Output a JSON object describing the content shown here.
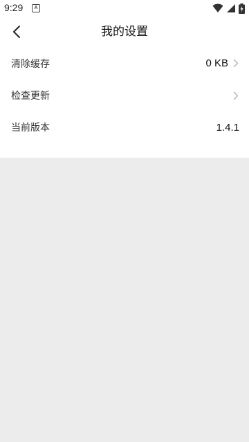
{
  "status_bar": {
    "time": "9:29",
    "notification_icon": "a-letter-icon",
    "icons": [
      "wifi-icon",
      "cellular-signal-icon",
      "battery-charging-icon"
    ]
  },
  "header": {
    "back_icon": "chevron-left-icon",
    "title": "我的设置"
  },
  "settings": {
    "items": [
      {
        "label": "清除缓存",
        "value": "0 KB",
        "has_chevron": true
      },
      {
        "label": "检查更新",
        "value": "",
        "has_chevron": true
      },
      {
        "label": "当前版本",
        "value": "1.4.1",
        "has_chevron": false
      }
    ]
  },
  "colors": {
    "page_background": "#ececec",
    "card_background": "#ffffff",
    "chevron": "#b0b0b0"
  }
}
